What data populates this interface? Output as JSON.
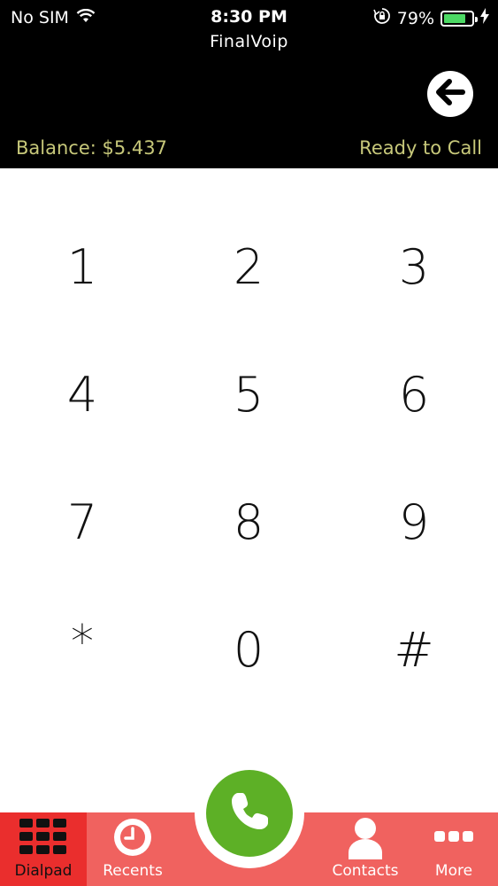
{
  "status_bar": {
    "carrier": "No SIM",
    "time": "8:30 PM",
    "battery_percent": "79%",
    "battery_level": 0.79,
    "battery_color": "#4cd964"
  },
  "header": {
    "app_title": "FinalVoip",
    "balance": "Balance: $5.437",
    "call_status": "Ready to Call",
    "back_icon": "arrow-left-circle-icon",
    "text_color": "#c7c87a"
  },
  "keypad": {
    "keys": [
      "1",
      "2",
      "3",
      "4",
      "5",
      "6",
      "7",
      "8",
      "9",
      "*",
      "0",
      "#"
    ]
  },
  "call_button": {
    "icon": "phone-icon",
    "color": "#5db026"
  },
  "tabbar": {
    "background": "#f0625f",
    "active_background": "#ea2e2d",
    "tabs": [
      {
        "label": "Dialpad",
        "icon": "grid-icon",
        "active": true
      },
      {
        "label": "Recents",
        "icon": "clock-icon",
        "active": false
      },
      {
        "label": "Contacts",
        "icon": "person-icon",
        "active": false
      },
      {
        "label": "More",
        "icon": "dots-icon",
        "active": false
      }
    ]
  }
}
